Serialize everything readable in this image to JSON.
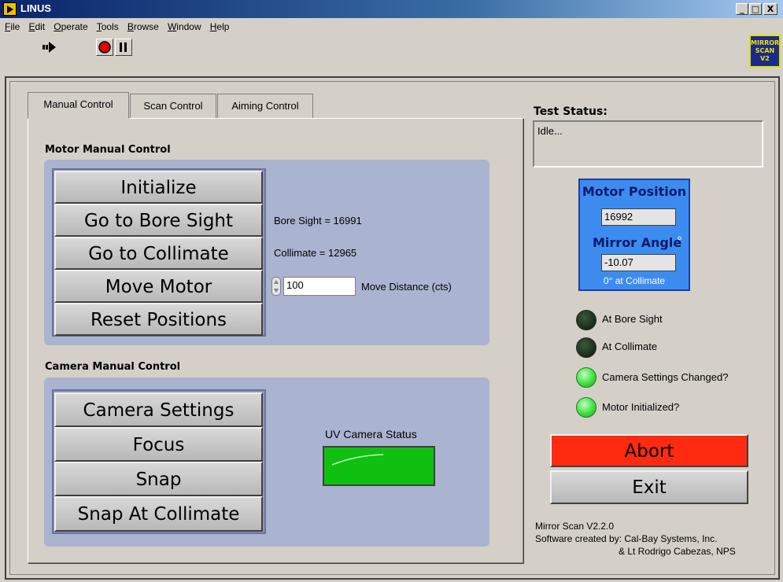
{
  "window": {
    "title": "LINUS",
    "min": "_",
    "max": "□",
    "close": "X"
  },
  "menu": [
    "File",
    "Edit",
    "Operate",
    "Tools",
    "Browse",
    "Window",
    "Help"
  ],
  "brand": {
    "line1": "MIRROR",
    "line2": "SCAN",
    "line3": "V2"
  },
  "tabs": [
    "Manual Control",
    "Scan Control",
    "Aiming Control"
  ],
  "motor": {
    "title": "Motor Manual Control",
    "buttons": [
      "Initialize",
      "Go to Bore Sight",
      "Go to Collimate",
      "Move Motor",
      "Reset Positions"
    ],
    "bore_sight": "Bore Sight = 16991",
    "collimate": "Collimate = 12965",
    "move_value": "100",
    "move_label": "Move Distance (cts)"
  },
  "camera": {
    "title": "Camera Manual Control",
    "buttons": [
      "Camera Settings",
      "Focus",
      "Snap",
      "Snap At Collimate"
    ],
    "status_label": "UV Camera Status",
    "status_color": "#10c010"
  },
  "status": {
    "label": "Test Status:",
    "value": "Idle..."
  },
  "position": {
    "motor_label": "Motor Position",
    "motor_value": "16992",
    "angle_label": "Mirror Angle",
    "angle_unit": "°",
    "angle_value": "-10.07",
    "note": "0° at Collimate"
  },
  "indicators": [
    {
      "label": "At Bore Sight",
      "state": "off"
    },
    {
      "label": "At Collimate",
      "state": "off"
    },
    {
      "label": "Camera Settings Changed?",
      "state": "on"
    },
    {
      "label": "Motor Initialized?",
      "state": "on"
    }
  ],
  "actions": {
    "abort": "Abort",
    "exit": "Exit",
    "abort_color": "#ff2a10"
  },
  "footer": {
    "line1": "Mirror Scan V2.2.0",
    "line2": "Software created by: Cal-Bay Systems, Inc.",
    "line3": "& Lt Rodrigo Cabezas, NPS"
  }
}
